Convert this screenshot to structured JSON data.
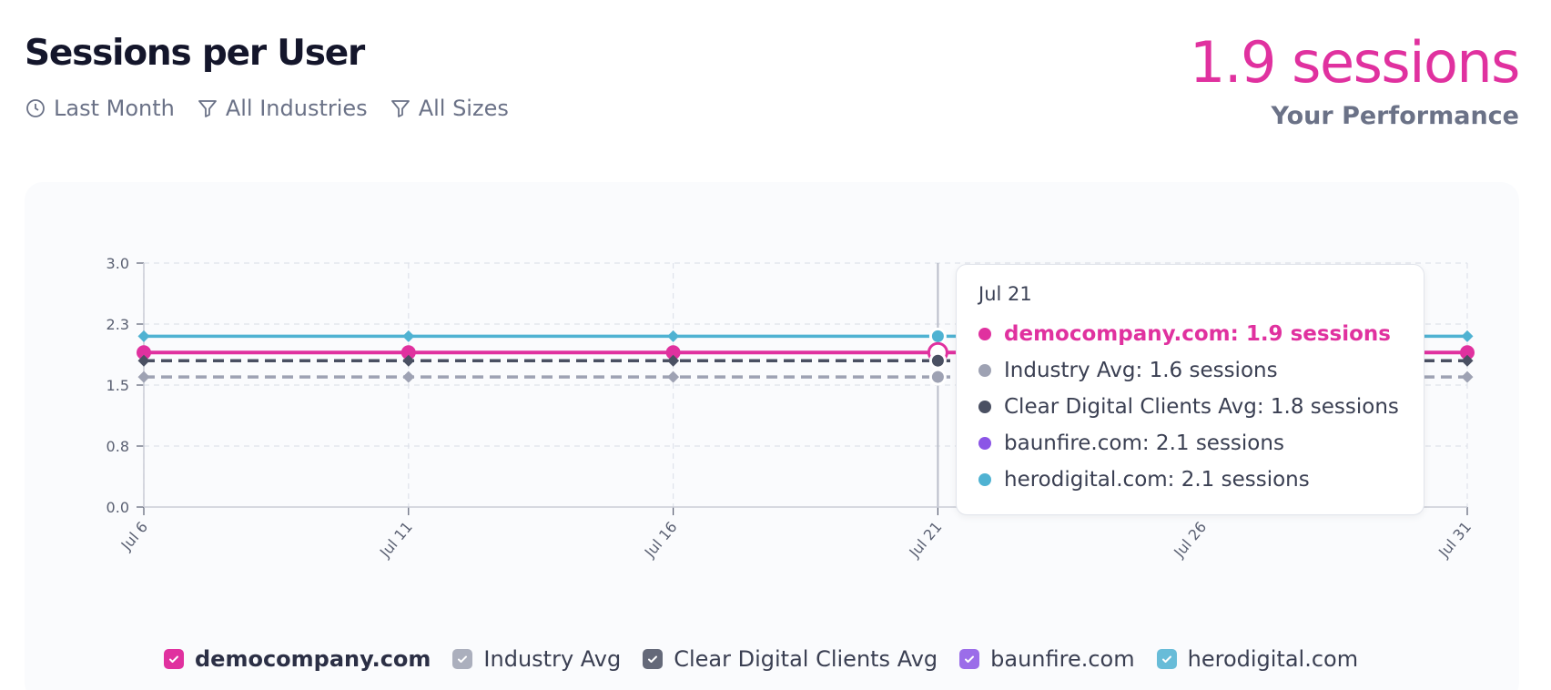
{
  "header": {
    "title": "Sessions per User",
    "filters": [
      {
        "label": "Last Month",
        "icon": "clock-icon"
      },
      {
        "label": "All Industries",
        "icon": "filter-icon"
      },
      {
        "label": "All Sizes",
        "icon": "filter-icon"
      }
    ],
    "performance_value": "1.9 sessions",
    "performance_label": "Your Performance"
  },
  "colors": {
    "accent": "#e0319f",
    "industry": "#9ea2b3",
    "clear_digital": "#4a5062",
    "baunfire": "#8b55e6",
    "herodigital": "#4fb2d2"
  },
  "tooltip": {
    "date": "Jul 21",
    "rows": [
      {
        "text": "democompany.com: 1.9 sessions",
        "color": "#e0319f",
        "highlight": true
      },
      {
        "text": "Industry Avg: 1.6 sessions",
        "color": "#9ea2b3",
        "highlight": false
      },
      {
        "text": "Clear Digital Clients Avg: 1.8 sessions",
        "color": "#4a5062",
        "highlight": false
      },
      {
        "text": "baunfire.com: 2.1 sessions",
        "color": "#8b55e6",
        "highlight": false
      },
      {
        "text": "herodigital.com: 2.1 sessions",
        "color": "#4fb2d2",
        "highlight": false
      }
    ]
  },
  "legend": [
    {
      "label": "democompany.com",
      "color": "#e0319f",
      "active": true
    },
    {
      "label": "Industry Avg",
      "color": "#9ea2b3",
      "active": false
    },
    {
      "label": "Clear Digital Clients Avg",
      "color": "#4a5062",
      "active": false
    },
    {
      "label": "baunfire.com",
      "color": "#8b55e6",
      "active": false
    },
    {
      "label": "herodigital.com",
      "color": "#4fb2d2",
      "active": false
    }
  ],
  "chart_data": {
    "type": "line",
    "x": [
      "Jul 6",
      "Jul 11",
      "Jul 16",
      "Jul 21",
      "Jul 26",
      "Jul 31"
    ],
    "y_ticks": [
      "3.0",
      "2.3",
      "1.5",
      "0.8",
      "0.0"
    ],
    "ylim": [
      0,
      3.0
    ],
    "grid": true,
    "hover_x": "Jul 21",
    "series": [
      {
        "name": "herodigital.com",
        "color": "#4fb2d2",
        "values": [
          2.1,
          2.1,
          2.1,
          2.1,
          2.1,
          2.1
        ],
        "dash": false,
        "marker": "diamond"
      },
      {
        "name": "democompany.com",
        "color": "#e0319f",
        "values": [
          1.9,
          1.9,
          1.9,
          1.9,
          1.9,
          1.9
        ],
        "dash": false,
        "marker": "circle"
      },
      {
        "name": "Clear Digital Clients Avg",
        "color": "#4a5062",
        "values": [
          1.8,
          1.8,
          1.8,
          1.8,
          1.8,
          1.8
        ],
        "dash": true,
        "marker": "diamond"
      },
      {
        "name": "Industry Avg",
        "color": "#9ea2b3",
        "values": [
          1.6,
          1.6,
          1.6,
          1.6,
          1.6,
          1.6
        ],
        "dash": true,
        "marker": "diamond"
      }
    ]
  }
}
